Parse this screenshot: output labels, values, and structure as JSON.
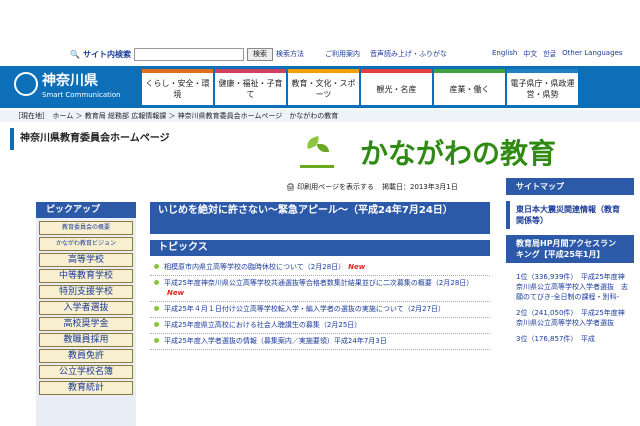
{
  "search": {
    "label": "サイト内検索",
    "button": "検索",
    "howto": "検索方法",
    "placeholder": ""
  },
  "util": [
    "ご利用案内",
    "音声読み上げ・ふりがな"
  ],
  "lang": [
    "English",
    "中文",
    "한글",
    "Other Languages"
  ],
  "logo": {
    "name": "神奈川県",
    "sub": "Smart Communication"
  },
  "nav": [
    "くらし・安全・環境",
    "健康・福祉・子育て",
    "教育・文化・スポーツ",
    "観光・名産",
    "産業・働く",
    "電子県庁・県政運営・県勢"
  ],
  "breadcrumb": "［現在地］　ホーム ＞ 教育局 総務部 広報情報課 ＞ 神奈川県教育委員会ホームページ　かながわの教育",
  "page_title": "神奈川県教育委員会ホームページ",
  "banner": "かながわの教育",
  "print_label": "印刷用ページを表示する",
  "date": "掲載日：2013年3月1日",
  "pickup": {
    "title": "ピックアップ",
    "items": [
      "教育委員会の概要",
      "かながわ教育ビジョン",
      "高等学校",
      "中等教育学校",
      "特別支援学校",
      "入学者選抜",
      "高校奨学金",
      "教職員採用",
      "教員免許",
      "公立学校名簿",
      "教育統計"
    ]
  },
  "appeal": "いじめを絶対に許さない～緊急アピール～（平成24年7月24日）",
  "topics": {
    "title": "トピックス",
    "new_label": "New",
    "items": [
      "相模原市内県立高等学校の臨時休校について（2月28日）",
      "平成25年度神奈川県公立高等学校共通選抜等合格者数集計結果並びに二次募集の概要（2月28日）",
      "平成25年４月１日付け公立高等学校転入学・編入学者の選抜の実施について（2月27日）",
      "平成25年度県立高校における社会人聴講生の募集（2月25日）",
      "平成25年度入学者選抜の情報（募集案内／実施要領）平成24年7月3日"
    ]
  },
  "right": {
    "sitemap": "サイトマップ",
    "disaster": "東日本大震災関連情報（教育関係等）",
    "ranking_title": "教育局HP月間アクセスランキング【平成25年1月】",
    "ranking": [
      "1位（336,939件）　平成25年度神奈川県公立高等学校入学者選抜　志願のてびき-全日制の課程・別科-",
      "2位（241,050件）　平成25年度神奈川県公立高等学校入学者選抜",
      "3位（176,857件）　平成"
    ]
  }
}
